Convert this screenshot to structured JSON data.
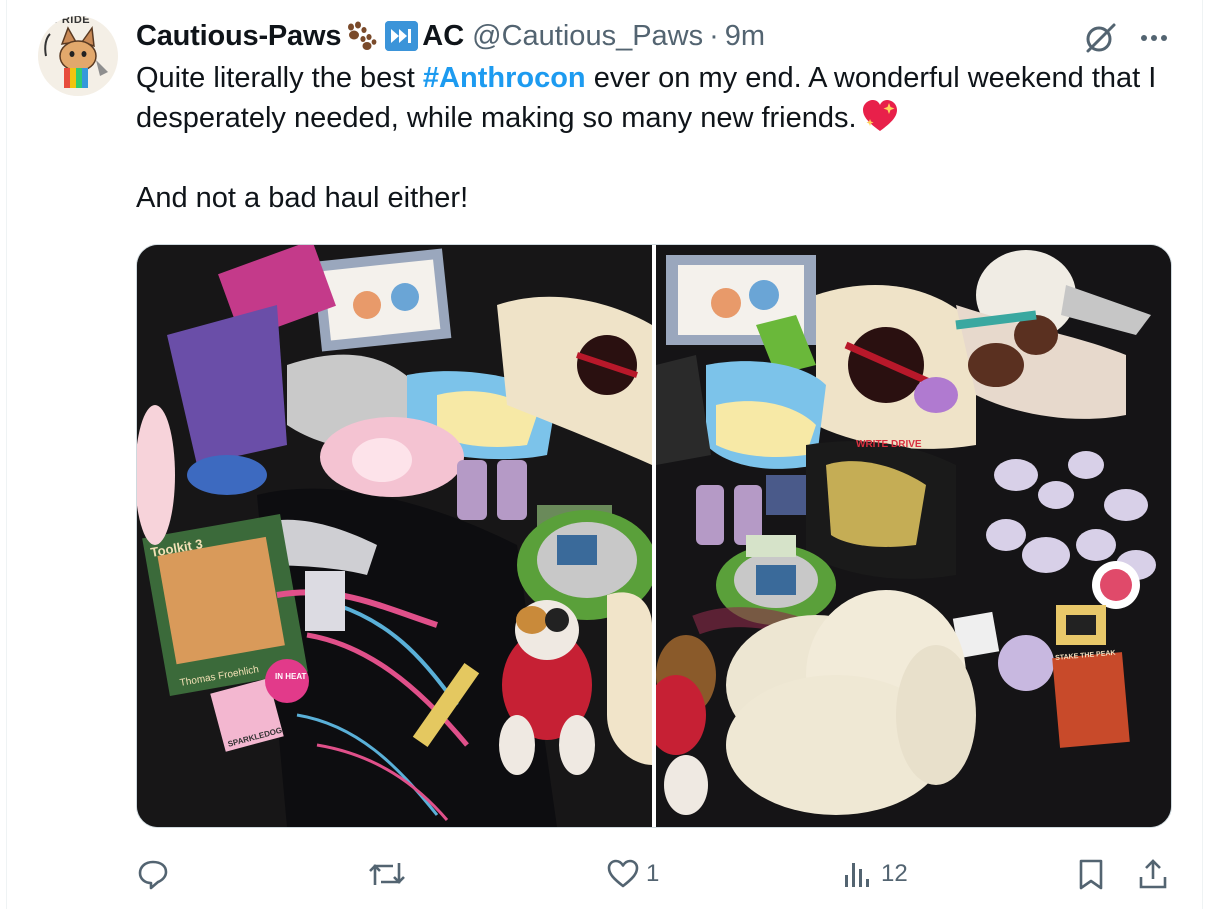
{
  "tweet": {
    "author": {
      "display_name": "Cautious-Paws",
      "name_suffix": "AC",
      "handle": "@Cautious_Paws",
      "separator": "·",
      "timestamp": "9m",
      "avatar_caption": "PRIDE"
    },
    "text": {
      "line1_before": "Quite literally the best ",
      "hashtag": "#Anthrocon",
      "line1_after": " ever on my end. A wonderful weekend that I desperately needed, while making so many new friends.",
      "line2": "And not a bad haul either!"
    },
    "media": {
      "left_photo": {
        "book_title": "Toolkit 3",
        "book_author": "Thomas Froehlich",
        "lanyard_text": "SPARKLEDOG",
        "badge_text": "IN HEAT"
      },
      "right_photo": {
        "sticker_text": "STAKE THE PEAK",
        "band_text": "WRITE DRIVE"
      }
    },
    "actions": {
      "reply_count": "",
      "retweet_count": "",
      "like_count": "1",
      "views_count": "12"
    }
  },
  "colors": {
    "accent": "#1d9bf0",
    "text_primary": "#0f1419",
    "text_secondary": "#536471",
    "emoji_heart": "#e8204a"
  },
  "icons": {
    "paw": "paw-prints-emoji",
    "fast_forward": "fast-forward-emoji",
    "heart": "sparkling-heart-emoji",
    "grok": "grok-icon",
    "more": "more-icon",
    "reply": "reply-icon",
    "retweet": "retweet-icon",
    "like": "heart-icon",
    "views": "views-icon",
    "bookmark": "bookmark-icon",
    "share": "share-icon"
  }
}
